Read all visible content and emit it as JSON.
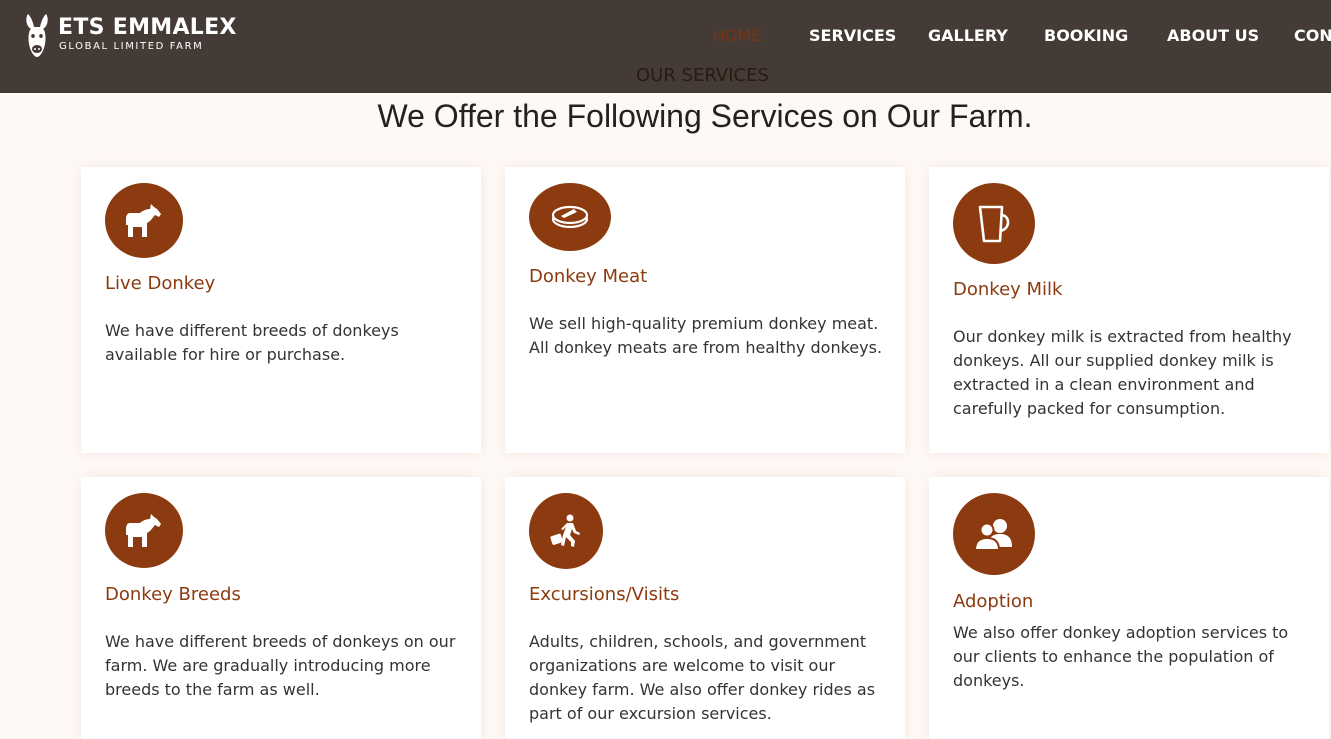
{
  "brand": {
    "name": "ETS EMMALEX",
    "subtitle": "GLOBAL LIMITED FARM",
    "mark_icon": "donkey-head-icon"
  },
  "nav": {
    "items": [
      {
        "label": "HOME",
        "active": true
      },
      {
        "label": "SERVICES",
        "active": false
      },
      {
        "label": "GALLERY",
        "active": false
      },
      {
        "label": "BOOKING",
        "active": false
      },
      {
        "label": "ABOUT US",
        "active": false
      },
      {
        "label": "CONT",
        "active": false
      }
    ],
    "active_color": "#7a3410"
  },
  "section": {
    "eyebrow": "OUR SERVICES",
    "title": "We Offer the Following Services on Our Farm."
  },
  "colors": {
    "header_bg": "#453b36",
    "accent": "#8b3b0f",
    "page_bg": "#fff9f6"
  },
  "services": [
    {
      "title": "Live Donkey",
      "icon": "donkey-icon",
      "text": "We have different breeds of donkeys available for hire or purchase."
    },
    {
      "title": "Donkey Meat",
      "icon": "steak-icon",
      "text": "We sell high-quality premium donkey meat. All donkey meats are from healthy donkeys."
    },
    {
      "title": "Donkey Milk",
      "icon": "mug-icon",
      "text": "Our donkey milk is extracted from healthy donkeys. All our supplied donkey milk is extracted in a clean environment and carefully packed for consumption."
    },
    {
      "title": "Donkey Breeds",
      "icon": "donkey-icon",
      "text": "We have different breeds of donkeys on our farm. We are gradually introducing more breeds to the farm as well."
    },
    {
      "title": "Excursions/Visits",
      "icon": "traveler-icon",
      "text": "Adults, children, schools, and government organizations are welcome to visit our donkey farm. We also offer donkey rides as part of our excursion services."
    },
    {
      "title": "Adoption",
      "icon": "users-icon",
      "text": "We also offer donkey adoption services to our clients to enhance the population of donkeys."
    }
  ]
}
